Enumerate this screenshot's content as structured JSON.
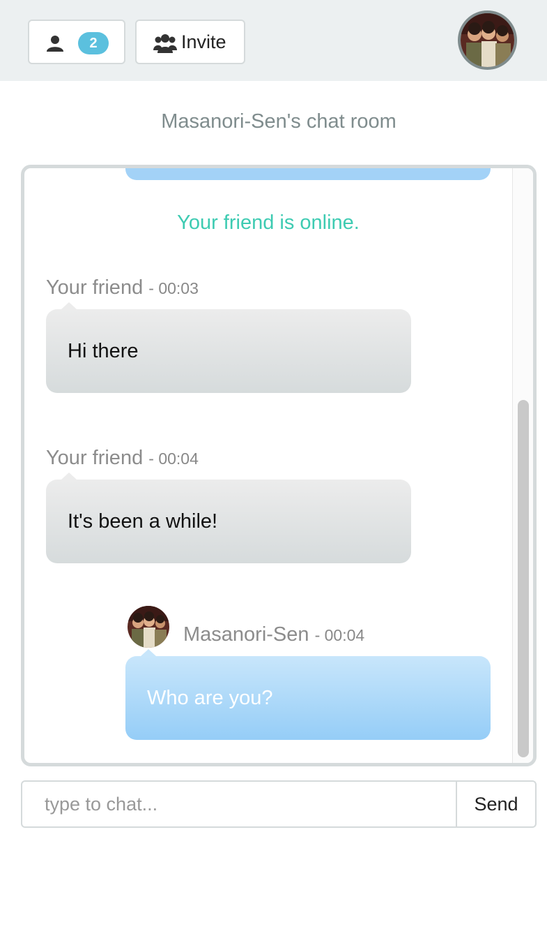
{
  "header": {
    "user_count": "2",
    "invite_label": "Invite"
  },
  "room_title": "Masanori-Sen's chat room",
  "chat": {
    "system_message": "Your friend is online.",
    "messages": [
      {
        "sender": "Your friend",
        "time": "- 00:03",
        "text": "Hi there"
      },
      {
        "sender": "Your friend",
        "time": "- 00:04",
        "text": "It's been a while!"
      },
      {
        "sender": "Masanori-Sen",
        "time": "- 00:04",
        "text": "Who are you?"
      }
    ]
  },
  "composer": {
    "placeholder": "type to chat...",
    "send_label": "Send"
  },
  "colors": {
    "accent_badge": "#5bc0de",
    "online_text": "#3ecbb2",
    "own_bubble": "#a3d2f7",
    "friend_bubble": "#dfe3e4"
  }
}
